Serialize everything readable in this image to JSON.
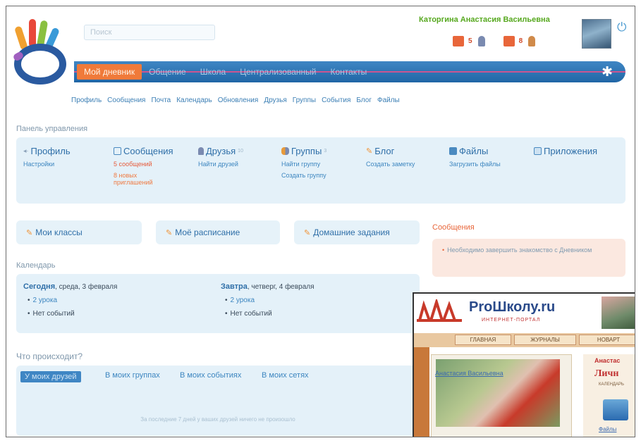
{
  "header": {
    "search_placeholder": "Поиск",
    "user_name": "Каторгина Анастасия Васильевна",
    "counters": [
      {
        "icon": "envelope-icon",
        "value": "5",
        "color": "#e8663a"
      },
      {
        "icon": "person-icon",
        "value": "",
        "color": "#7a8ab0"
      },
      {
        "icon": "invite-icon",
        "value": "8",
        "color": "#e8663a"
      },
      {
        "icon": "child-icon",
        "value": "",
        "color": "#d08a4a"
      }
    ]
  },
  "nav": {
    "items": [
      "Мой дневник",
      "Общение",
      "Школа",
      "Централизованный",
      "Контакты"
    ]
  },
  "subnav": [
    "Профиль",
    "Сообщения",
    "Почта",
    "Календарь",
    "Обновления",
    "Друзья",
    "Группы",
    "События",
    "Блог",
    "Файлы"
  ],
  "panel": {
    "title": "Панель управления",
    "columns": [
      {
        "title": "Профиль",
        "icon": "profile-icon",
        "links": [
          "Настройки"
        ]
      },
      {
        "title": "Сообщения",
        "icon": "messages-icon",
        "links": [
          "5 сообщений",
          "8 новых приглашений"
        ]
      },
      {
        "title": "Друзья",
        "icon": "friends-icon",
        "count": "10",
        "links": [
          "Найти друзей"
        ]
      },
      {
        "title": "Группы",
        "icon": "groups-icon",
        "count": "3",
        "links": [
          "Найти группу",
          "Создать группу"
        ]
      },
      {
        "title": "Блог",
        "icon": "blog-icon",
        "links": [
          "Создать заметку"
        ]
      },
      {
        "title": "Файлы",
        "icon": "files-icon",
        "links": [
          "Загрузить файлы"
        ]
      },
      {
        "title": "Приложения",
        "icon": "apps-icon",
        "links": []
      }
    ]
  },
  "quick": [
    "Мои классы",
    "Моё расписание",
    "Домашние задания"
  ],
  "messages": {
    "title": "Сообщения",
    "text": "Необходимо завершить знакомство с Дневником"
  },
  "calendar": {
    "title": "Календарь",
    "today": {
      "label": "Сегодня",
      "date": ", среда, 3 февраля",
      "lessons": "2 урока",
      "events": "Нет событий"
    },
    "tomorrow": {
      "label": "Завтра",
      "date": ", четверг, 4 февраля",
      "lessons": "2 урока",
      "events": "Нет событий"
    }
  },
  "feed": {
    "title": "Что происходит?",
    "tabs": [
      "У моих друзей",
      "В моих группах",
      "В моих событиях",
      "В моих сетях"
    ],
    "empty": "За последние 7 дней у ваших друзей ничего не произошло"
  },
  "inset": {
    "title": "ProШколу.ru",
    "subtitle": "ИНТЕРНЕТ-ПОРТАЛ",
    "tabs": [
      "ГЛАВНАЯ",
      "ЖУРНАЛЫ",
      "НОВАРТ"
    ],
    "caption": "Анастасия Васильевна",
    "right_name": "Анастас",
    "right_title": "Личн",
    "right_small": "КАЛЕНДАРЬ",
    "right_link": "Файлы"
  }
}
